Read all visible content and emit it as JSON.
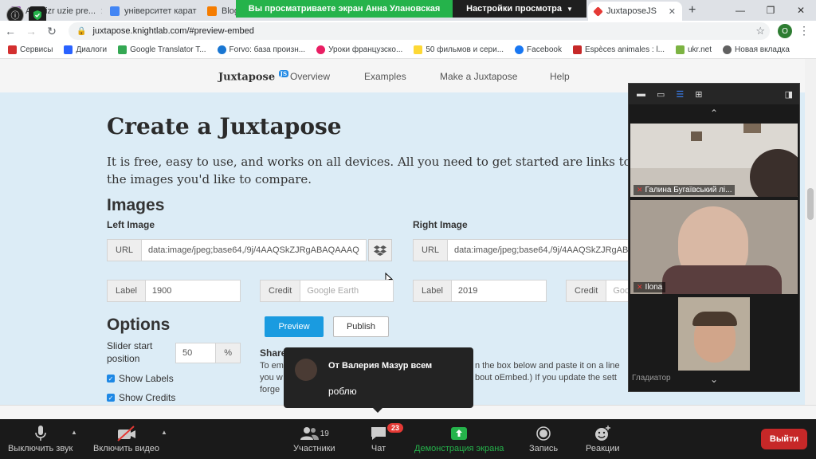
{
  "tabs": [
    {
      "label": "Ani...izr uzie pre...",
      "color": "#8e44ad"
    },
    {
      "label": "університет карат",
      "color": "#4285f4"
    },
    {
      "label": "Blogg",
      "color": "#f57c00"
    },
    {
      "label": "JuxtaposeJS",
      "color": "#e53935"
    }
  ],
  "share_banner": {
    "viewing": "Вы просматриваете экран Анна Улановская",
    "settings": "Настройки просмотра"
  },
  "address": {
    "url": "juxtapose.knightlab.com/#preview-embed"
  },
  "profile_initial": "O",
  "bookmarks": [
    {
      "label": "Сервисы",
      "color": "#d32f2f"
    },
    {
      "label": "Диалоги",
      "color": "#2962ff"
    },
    {
      "label": "Google Translator T...",
      "color": "#34a853"
    },
    {
      "label": "Forvo: база произн...",
      "color": "#1976d2"
    },
    {
      "label": "Уроки французско...",
      "color": "#e91e63"
    },
    {
      "label": "50 фильмов и сери...",
      "color": "#fdd835"
    },
    {
      "label": "Facebook",
      "color": "#1877f2"
    },
    {
      "label": "Espèces animales : l...",
      "color": "#c62828"
    },
    {
      "label": "ukr.net",
      "color": "#7cb342"
    },
    {
      "label": "Новая вкладка",
      "color": "#616161"
    }
  ],
  "site": {
    "logo": "Juxtapose",
    "logo_badge": "JS",
    "nav": [
      "Overview",
      "Examples",
      "Make a Juxtapose",
      "Help"
    ],
    "title": "Create a Juxtapose",
    "lead": "It is free, easy to use, and works on all devices. All you need to get started are links to the images you'd like to compare.",
    "images_heading": "Images",
    "left_image_label": "Left Image",
    "right_image_label": "Right Image",
    "url_addon": "URL",
    "left_url": "data:image/jpeg;base64,/9j/4AAQSkZJRgABAQAAAQ",
    "right_url": "data:image/jpeg;base64,/9j/4AAQSkZJRgABAQ",
    "label_addon": "Label",
    "left_label_value": "1900",
    "right_label_value": "2019",
    "credit_addon": "Credit",
    "left_credit_placeholder": "Google Earth",
    "right_credit_placeholder": "Goo",
    "options_heading": "Options",
    "slider_start_label": "Slider start position",
    "slider_value": "50",
    "slider_unit": "%",
    "show_labels": "Show Labels",
    "show_credits": "Show Credits",
    "preview_btn": "Preview",
    "publish_btn": "Publish",
    "share_heading": "Share",
    "embed_text_1": "To em",
    "embed_text_1b": "n the box below and paste it on a line",
    "embed_text_2": "you w",
    "embed_text_2b": "bout oEmbed.) If you update the sett",
    "embed_text_3": "forge"
  },
  "participants": [
    {
      "name": "Галина Бугаївський лі...",
      "muted": true
    },
    {
      "name": "Ilona",
      "muted": true
    },
    {
      "name": "Гладиатор",
      "muted": false
    }
  ],
  "chat_popup": {
    "from": "От Валерия Мазур всем",
    "message": "роблю"
  },
  "toolbar": {
    "mute": "Выключить звук",
    "video": "Включить видео",
    "participants": "Участники",
    "participants_count": "19",
    "chat": "Чат",
    "chat_badge": "23",
    "share": "Демонстрация экрана",
    "record": "Запись",
    "reactions": "Реакции",
    "leave": "Выйти"
  },
  "accent_green": "#25b34b",
  "leave_color": "#c62828"
}
